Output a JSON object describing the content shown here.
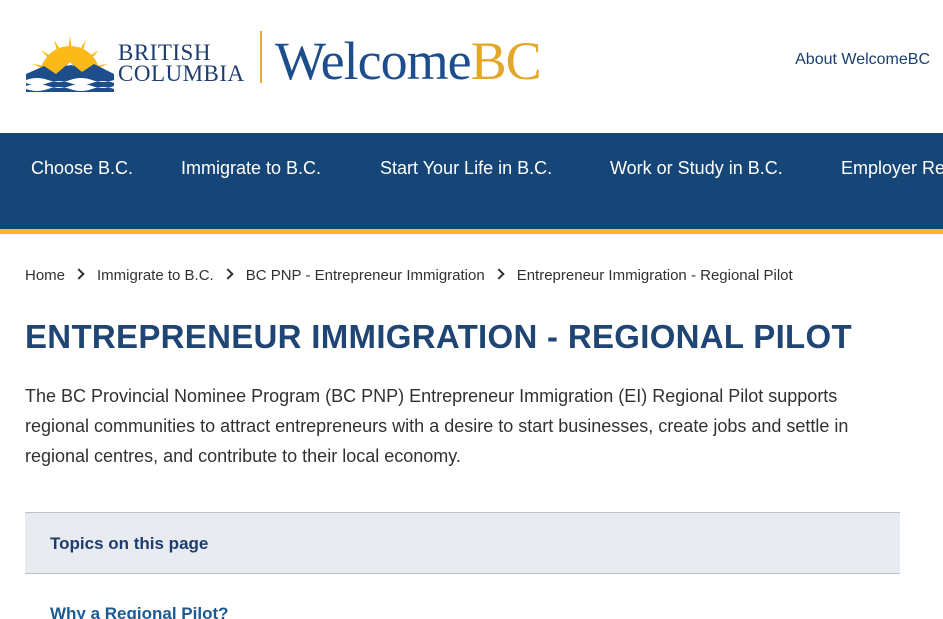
{
  "header": {
    "bc_logo_line1": "BRITISH",
    "bc_logo_line2": "COLUMBIA",
    "welcome_part1": "Welcome",
    "welcome_part2": "BC",
    "about_link": "About WelcomeBC"
  },
  "nav": {
    "items": [
      {
        "label": "Choose B.C."
      },
      {
        "label": "Immigrate to B.C."
      },
      {
        "label": "Start Your Life in B.C."
      },
      {
        "label": "Work or Study in B.C."
      },
      {
        "label": "Employer Re"
      }
    ]
  },
  "breadcrumb": {
    "items": [
      {
        "label": "Home"
      },
      {
        "label": "Immigrate to B.C."
      },
      {
        "label": "BC PNP - Entrepreneur Immigration"
      },
      {
        "label": "Entrepreneur Immigration - Regional Pilot"
      }
    ]
  },
  "main": {
    "title": "ENTREPRENEUR IMMIGRATION - REGIONAL PILOT",
    "intro": "The BC Provincial Nominee Program (BC PNP) Entrepreneur Immigration (EI) Regional Pilot supports regional communities to attract entrepreneurs with a desire to start businesses, create jobs and settle in regional centres, and contribute to their local economy.",
    "topics_heading": "Topics on this page",
    "topic_links": [
      {
        "label": "Why a Regional Pilot?"
      }
    ]
  },
  "colors": {
    "nav_background": "#164677",
    "accent_gold": "#fcba19",
    "title_blue": "#1e4573",
    "topics_background": "#e8ecf1"
  }
}
